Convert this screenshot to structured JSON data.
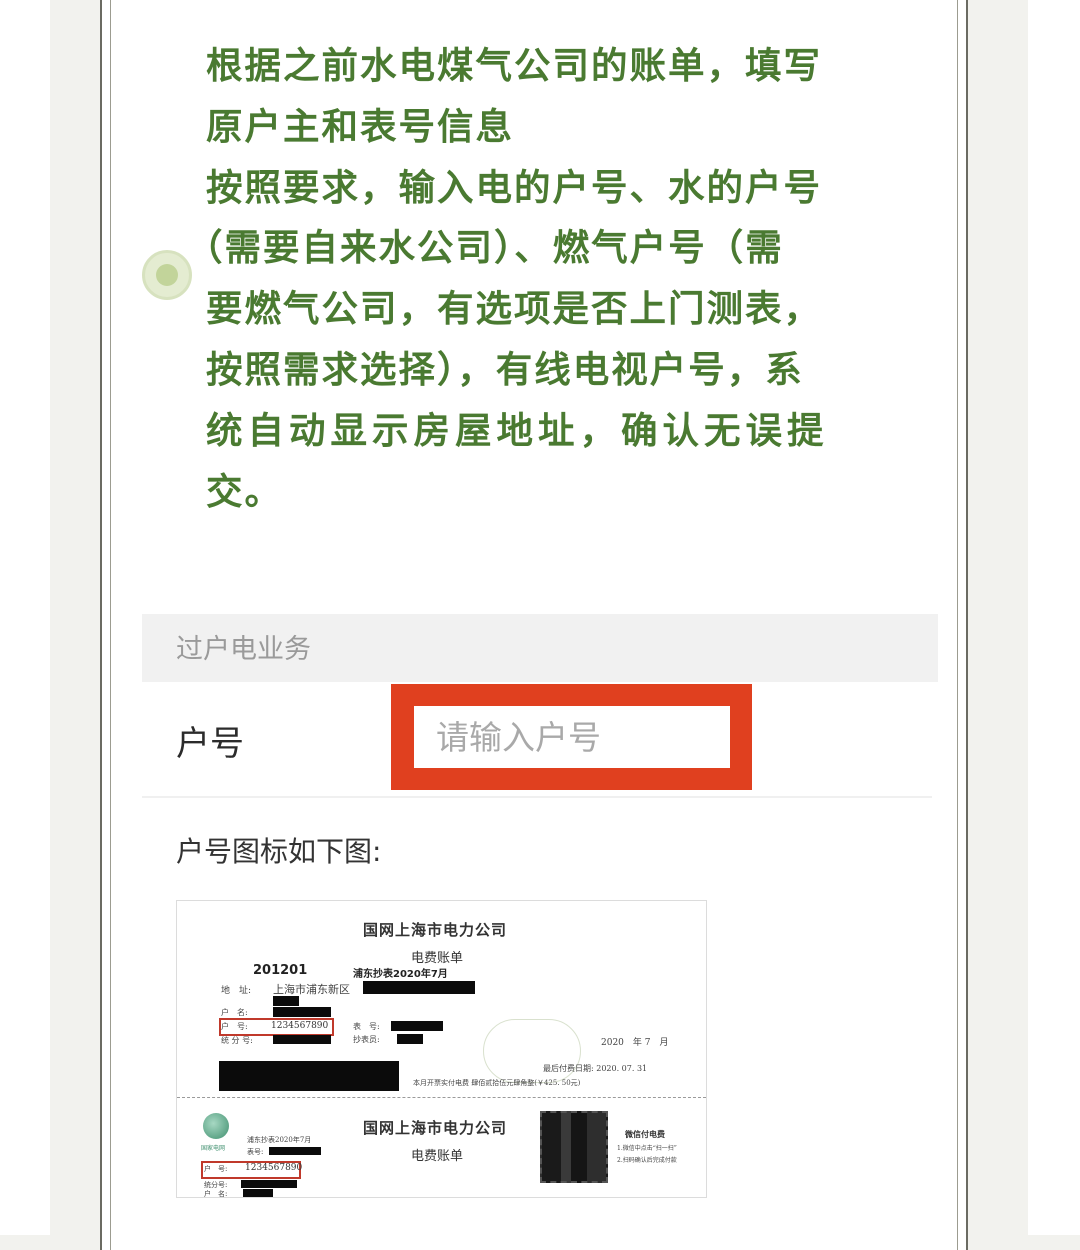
{
  "instructions": {
    "lines": [
      "根据之前水电煤气公司的账单，填写",
      "原户主和表号信息",
      "按照要求，输入电的户号、水的户号",
      "（需要自来水公司）、燃气户号（需",
      "要燃气公司，有选项是否上门测表，",
      "按照需求选择），有线电视户号，系",
      "统自动显示房屋地址，确认无误提",
      "交。"
    ]
  },
  "section": {
    "title": "过户电业务"
  },
  "account_field": {
    "label": "户号",
    "placeholder": "请输入户号"
  },
  "hint": "户号图标如下图:",
  "bill": {
    "company": "国网上海市电力公司",
    "bill_title": "电费账单",
    "code": "201201",
    "reading": "浦东抄表2020年7月",
    "address_label": "地　址:",
    "address": "上海市浦东新区",
    "name_label": "户　名:",
    "account_label": "户　号:",
    "account_no": "1234567890",
    "meter_label": "表　号:",
    "reader_label": "抄表员:",
    "class_label": "统 分 号:",
    "year_month": "2020　年 7　月",
    "last_pay_date": "最后付费日期: 2020. 07. 31",
    "amount_line": "本月开票实付电费 肆佰贰拾伍元肆角整(￥425. 50元)",
    "wechat_title": "微信付电费",
    "wechat_step1": "1.微信中点击“扫一扫”",
    "wechat_step2": "2.扫码确认后完成付款",
    "lower_reading": "浦东抄表2020年7月",
    "lower_meter_label": "表号:",
    "lower_account_label": "户　号:",
    "lower_account_no": "1234567890",
    "lower_class_label": "统分号:",
    "lower_name_label": "户　名:",
    "logo_text": "国家电网"
  },
  "colors": {
    "instruction_text": "#4a7a31",
    "highlight_frame": "#e0401f",
    "bullet": "#c2d49a"
  }
}
